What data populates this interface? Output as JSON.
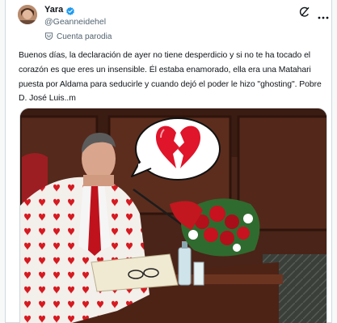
{
  "author": {
    "display_name": "Yara",
    "handle": "@Geanneidehel",
    "badge": "Cuenta parodia",
    "verified_color": "#1d9bf0"
  },
  "tweet": {
    "text": "Buenos días, la declaración de ayer no tiene desperdicio y si no te ha tocado el corazón es que eres un insensible. Él estaba enamorado, ella era una Matahari puesta por Aldama para seducirle y cuando dejó el poder le hizo \"ghosting\". Pobre D. José Luis..m"
  },
  "media": {
    "description_icon": "broken-heart-icon",
    "colors": {
      "heart": "#e0142a",
      "jacket_hearts": "#d71920",
      "wood": "#5a2d1c"
    }
  }
}
